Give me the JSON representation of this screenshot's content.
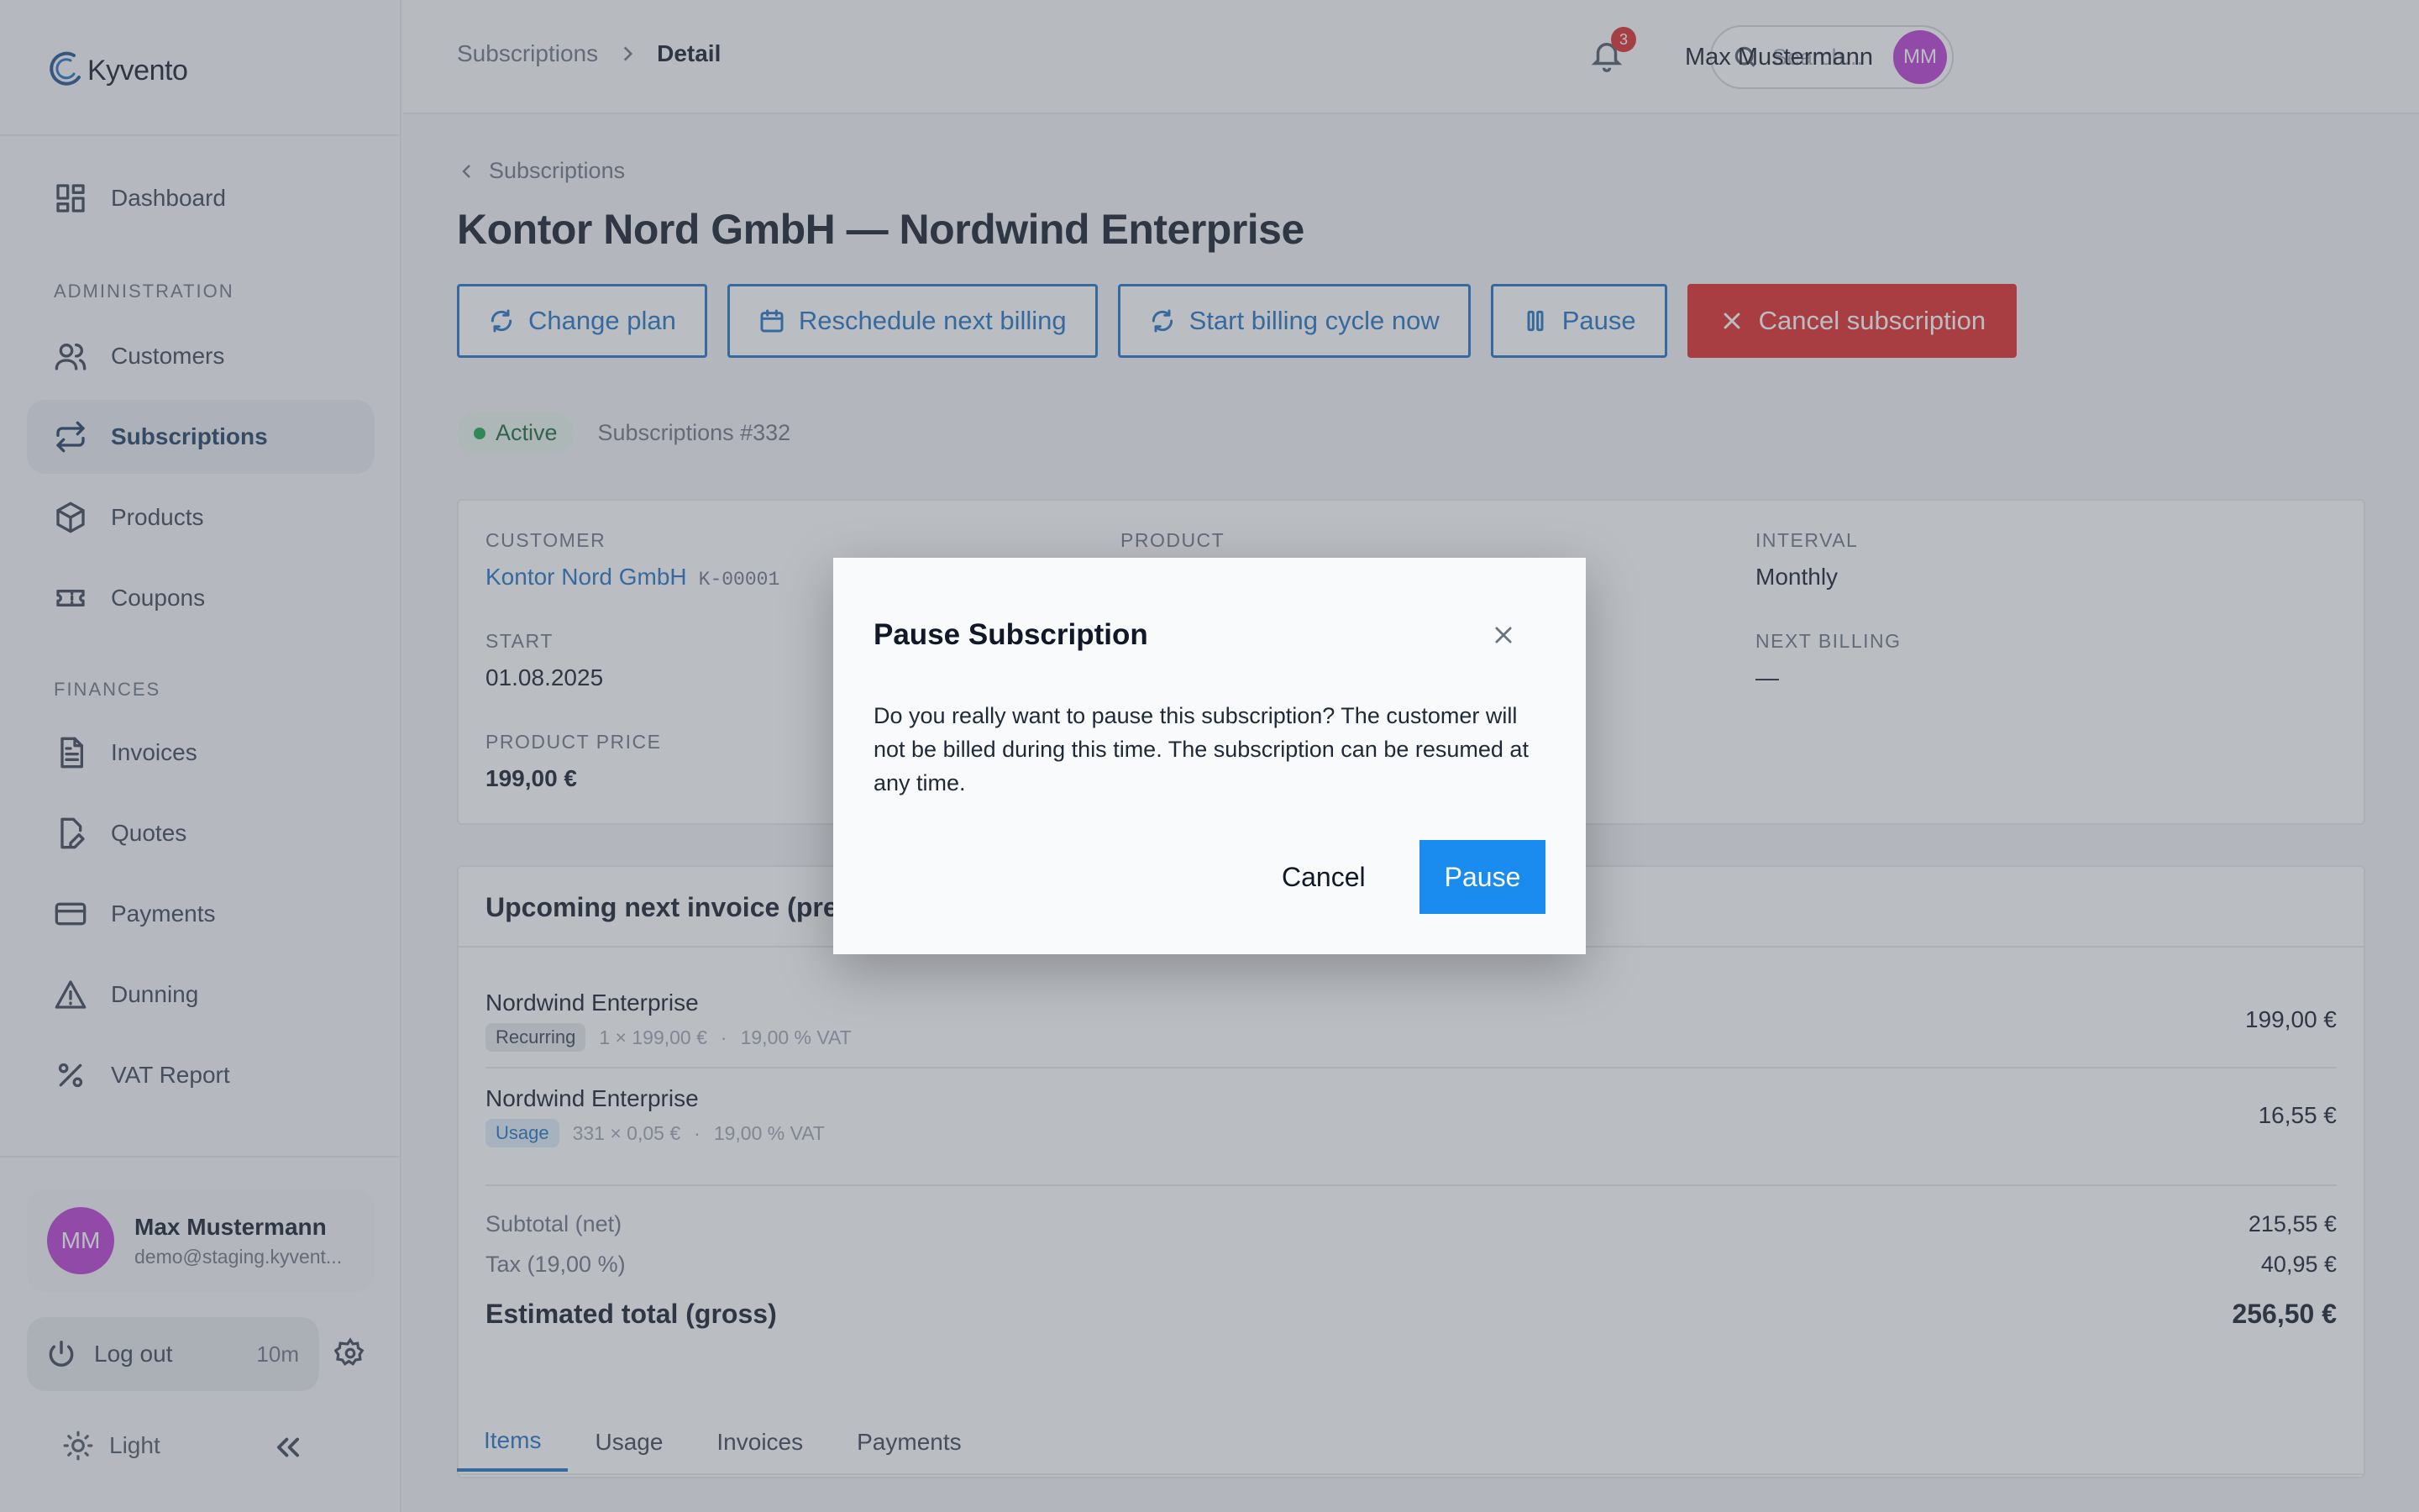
{
  "app": {
    "brand": "Kyvento"
  },
  "sidebar": {
    "dashboard": "Dashboard",
    "section_admin": "ADMINISTRATION",
    "customers": "Customers",
    "subscriptions": "Subscriptions",
    "products": "Products",
    "coupons": "Coupons",
    "section_finances": "FINANCES",
    "invoices": "Invoices",
    "quotes": "Quotes",
    "payments": "Payments",
    "dunning": "Dunning",
    "vat_report": "VAT Report",
    "user_initials": "MM",
    "user_name": "Max Mustermann",
    "user_email": "demo@staging.kyvent...",
    "logout_label": "Log out",
    "logout_timer": "10m",
    "theme_label": "Light"
  },
  "topbar": {
    "crumb_parent": "Subscriptions",
    "crumb_current": "Detail",
    "search_placeholder": "Search...",
    "search_shortcut": "⌘K",
    "notification_count": "3",
    "user_name": "Max Mustermann",
    "user_initials": "MM"
  },
  "page": {
    "back_label": "Subscriptions",
    "title": "Kontor Nord GmbH — Nordwind Enterprise",
    "actions": {
      "change_plan": "Change plan",
      "reschedule": "Reschedule next billing",
      "start_cycle": "Start billing cycle now",
      "pause": "Pause",
      "cancel": "Cancel subscription"
    },
    "status": "Active",
    "reference": "Subscriptions #332"
  },
  "details": {
    "customer_label": "CUSTOMER",
    "customer_value": "Kontor Nord GmbH",
    "customer_id": "K-00001",
    "product_label": "PRODUCT",
    "interval_label": "INTERVAL",
    "interval_value": "Monthly",
    "start_label": "START",
    "start_value": "01.08.2025",
    "next_billing_label": "NEXT BILLING",
    "next_billing_value": "—",
    "price_label": "PRODUCT PRICE",
    "price_value": "199,00 €"
  },
  "invoice": {
    "heading": "Upcoming next invoice (prev",
    "lines": [
      {
        "title": "Nordwind Enterprise",
        "tag": "Recurring",
        "qty": "1 × 199,00 €",
        "vat": "19,00 % VAT",
        "amount": "199,00 €"
      },
      {
        "title": "Nordwind Enterprise",
        "tag": "Usage",
        "qty": "331 × 0,05 €",
        "vat": "19,00 % VAT",
        "amount": "16,55 €"
      }
    ],
    "separator": "·",
    "subtotal_label": "Subtotal (net)",
    "subtotal_value": "215,55 €",
    "tax_label": "Tax (19,00 %)",
    "tax_value": "40,95 €",
    "total_label": "Estimated total (gross)",
    "total_value": "256,50 €"
  },
  "tabs": [
    "Items",
    "Usage",
    "Invoices",
    "Payments"
  ],
  "modal": {
    "title": "Pause Subscription",
    "body": "Do you really want to pause this subscription? The customer will not be billed during this time. The subscription can be resumed at any time.",
    "cancel": "Cancel",
    "confirm": "Pause"
  },
  "colors": {
    "accent": "#1d6fc0",
    "danger": "#e02424",
    "confirm": "#1a8cf0",
    "avatar": "#b93ad1",
    "active_dot": "#16a34a"
  }
}
